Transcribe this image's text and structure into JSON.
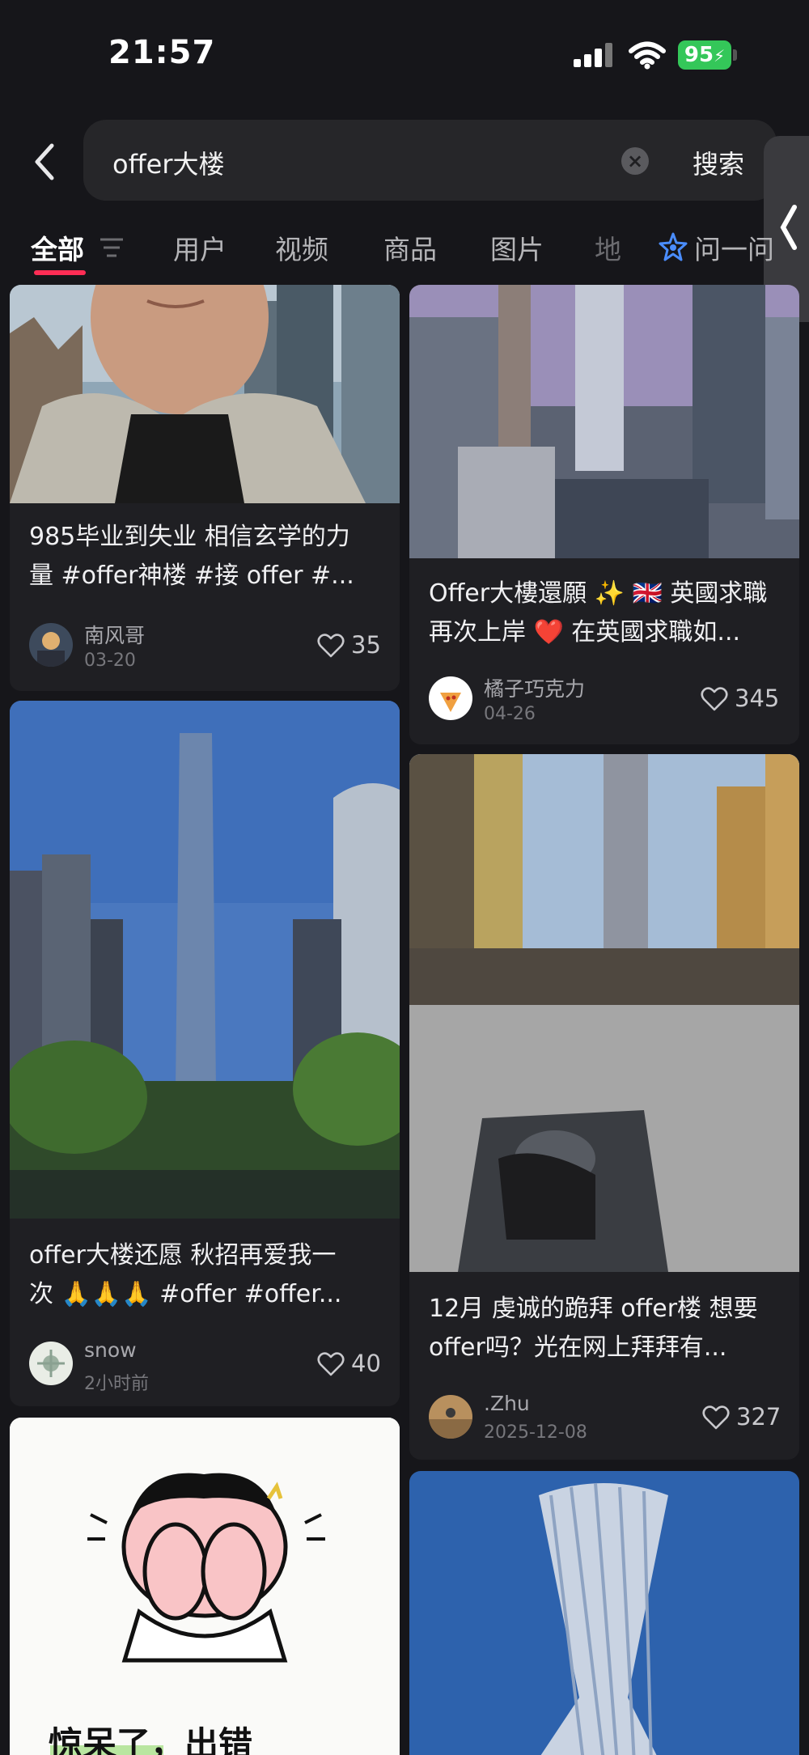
{
  "status_bar": {
    "time": "21:57",
    "battery": "95"
  },
  "search": {
    "query": "offer大楼",
    "button_label": "搜索"
  },
  "tabs": [
    {
      "label": "全部",
      "active": true
    },
    {
      "label": "用户"
    },
    {
      "label": "视频"
    },
    {
      "label": "商品"
    },
    {
      "label": "图片"
    },
    {
      "label": "地"
    },
    {
      "label": "问一问"
    }
  ],
  "posts": [
    {
      "title_line1": "985毕业到失业 相信玄学的力",
      "title_line2": "量 #offer神楼 #接 offer #...",
      "author": "南风哥",
      "date": "03-20",
      "likes": "35"
    },
    {
      "title_line1": "Offer大樓還願 ✨ 🇬🇧 英國求職",
      "title_line2": "再次上岸 ❤️ 在英國求職如...",
      "author": "橘子巧克力",
      "date": "04-26",
      "likes": "345"
    },
    {
      "title_line1": "offer大楼还愿 秋招再爱我一",
      "title_line2": "次 🙏🙏🙏 #offer  #offer...",
      "author": "snow",
      "date": "2小时前",
      "likes": "40"
    },
    {
      "title_line1": "12月 虔诚的跪拜 offer楼 想要",
      "title_line2": "offer吗？光在网上拜拜有...",
      "author": ".Zhu",
      "date": "2025-12-08",
      "likes": "327"
    },
    {
      "image_text": "惊呆了，出错"
    }
  ],
  "colors": {
    "background": "#16161a",
    "card": "#1f1f23",
    "accent": "#ff2d55",
    "battery": "#34c759"
  }
}
